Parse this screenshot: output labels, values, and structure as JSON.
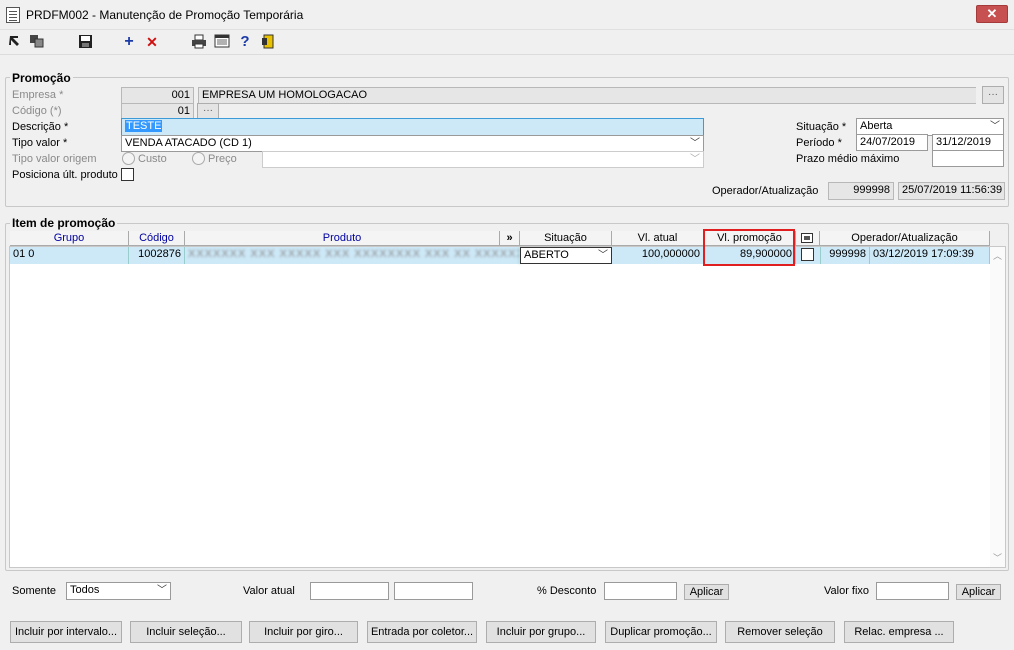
{
  "window": {
    "title": "PRDFM002 - Manutenção de Promoção Temporária",
    "close": "✕"
  },
  "toolbar": {
    "icons": [
      "first-record-icon",
      "copy-icon",
      "save-icon",
      "add-icon",
      "delete-icon",
      "print-icon",
      "calculator-icon",
      "help-icon",
      "exit-icon"
    ],
    "add_glyph": "+",
    "delete_glyph": "✕",
    "help_glyph": "?"
  },
  "promocao": {
    "section_title": "Promoção",
    "empresa_label": "Empresa *",
    "empresa_code": "001",
    "empresa_name": "EMPRESA UM  HOMOLOGACAO",
    "codigo_label": "Código (*)",
    "codigo_value": "01",
    "descricao_label": "Descrição *",
    "descricao_value": "TESTE",
    "tipo_valor_label": "Tipo valor *",
    "tipo_valor_value": "VENDA ATACADO (CD 1)",
    "tipo_valor_origem_label": "Tipo valor origem",
    "radio_custo": "Custo",
    "radio_preco": "Preço",
    "posiciona_label": "Posiciona últ. produto",
    "situacao_label": "Situação *",
    "situacao_value": "Aberta",
    "periodo_label": "Período *",
    "periodo_inicio": "24/07/2019",
    "periodo_fim": "31/12/2019",
    "prazo_label": "Prazo médio máximo",
    "operador_label": "Operador/Atualização",
    "operador_value": "999998",
    "atualizacao_value": "25/07/2019 11:56:39"
  },
  "item": {
    "section_title": "Item de promoção",
    "columns": {
      "grupo": "Grupo",
      "codigo": "Código",
      "produto": "Produto",
      "expand": "»",
      "situacao": "Situação",
      "vl_atual": "Vl. atual",
      "vl_promocao": "Vl. promoção",
      "operador": "Operador/Atualização"
    },
    "rows": [
      {
        "grupo": "01 0",
        "codigo": "1002876",
        "produto": "XXXXXXX XXX XXXXX XXX XXXXXXXX XXX XX XXXXXX XXX",
        "situacao": "ABERTO",
        "vl_atual": "100,000000",
        "vl_promocao": "89,900000",
        "operador": "999998",
        "atualizacao": "03/12/2019 17:09:39"
      }
    ]
  },
  "filters": {
    "somente_label": "Somente",
    "somente_value": "Todos",
    "valor_atual_label": "Valor atual",
    "desconto_label": "% Desconto",
    "aplicar_label": "Aplicar",
    "valor_fixo_label": "Valor fixo"
  },
  "buttons": {
    "incluir_intervalo": "Incluir por intervalo...",
    "incluir_selecao": "Incluir seleção...",
    "incluir_giro": "Incluir por giro...",
    "entrada_coletor": "Entrada por coletor...",
    "incluir_grupo": "Incluir por grupo...",
    "duplicar_promocao": "Duplicar promoção...",
    "remover_selecao": "Remover seleção",
    "relac_empresa": "Relac. empresa ..."
  },
  "colors": {
    "selection_bg": "#cde8f7",
    "highlight_border": "#e02020",
    "header_blue": "#0000a0"
  }
}
